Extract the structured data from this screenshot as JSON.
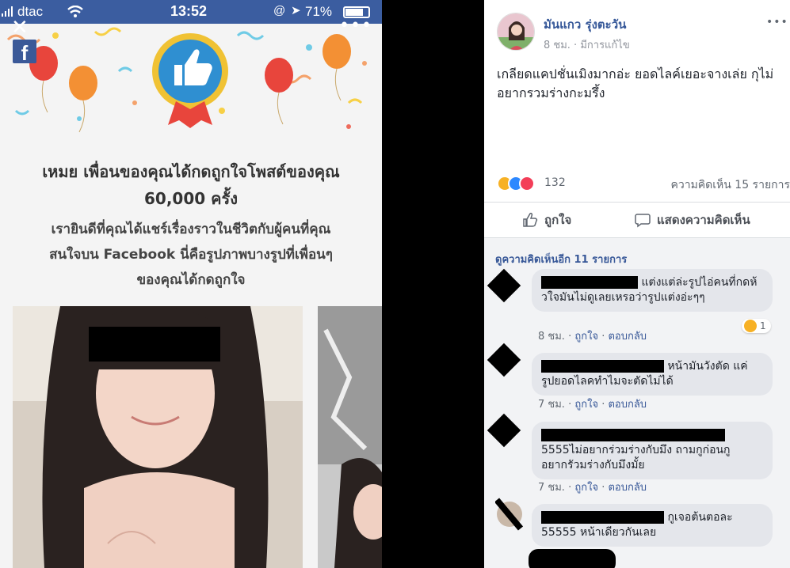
{
  "phone": {
    "status_bar": {
      "carrier": "dtac",
      "time": "13:52",
      "battery": "71%"
    },
    "banner": {
      "title_line1": "เหมย เพื่อนของคุณได้กดถูกใจโพสต์ของคุณ",
      "title_line2": "60,000 ครั้ง",
      "subtitle_line1": "เรายินดีที่คุณได้แชร์เรื่องราวในชีวิตกับผู้คนที่คุณ",
      "subtitle_line2": "สนใจบน Facebook นี่คือรูปภาพบางรูปที่เพื่อนๆ",
      "subtitle_line3": "ของคุณได้กดถูกใจ"
    }
  },
  "post": {
    "author": "มันแกว รุ่งตะวัน",
    "time": "8 ชม. · มีการแก้ไข",
    "text": "เกลียดแคปชั่นเมิงมากอ่ะ ยอดไลค์เยอะจางเล่ย กุไม่อยากรวมร่างกะมรึ้ง",
    "reaction_count": "132",
    "comment_count": "ความคิดเห็น 15 รายการ",
    "like_label": "ถูกใจ",
    "comment_label": "แสดงความคิดเห็น",
    "view_more": "ดูความคิดเห็นอีก 11 รายการ",
    "comments": [
      {
        "text": "แต่งแต่ล่ะรูปไอ่คนที่กดห้",
        "text2": "วใจมันไม่ดูเลยเหรอว่ารูปแต่งอ่ะๆๆ",
        "time": "8 ชม.",
        "like": "ถูกใจ",
        "reply": "ตอบกลับ",
        "react_count": "1"
      },
      {
        "text": "หน้ามันวังตัด แค่",
        "text2": "รูปยอดไลคทำไมจะตัดไม่ได้",
        "time": "7 ชม.",
        "like": "ถูกใจ",
        "reply": "ตอบกลับ"
      },
      {
        "text": "5555ไม่อยากร่วมร่างกับมึง ถามกูก่อนกู",
        "text2": "อยากรัวมร่างกับมึงมั้ย",
        "time": "7 ชม.",
        "like": "ถูกใจ",
        "reply": "ตอบกลับ"
      },
      {
        "text": "กูเจอต้นตอละ",
        "text2": "55555 หน้าเดียวกันเลย"
      }
    ]
  },
  "colors": {
    "fb_blue": "#3b5998",
    "link": "#385898",
    "bubble": "#e4e6eb"
  }
}
